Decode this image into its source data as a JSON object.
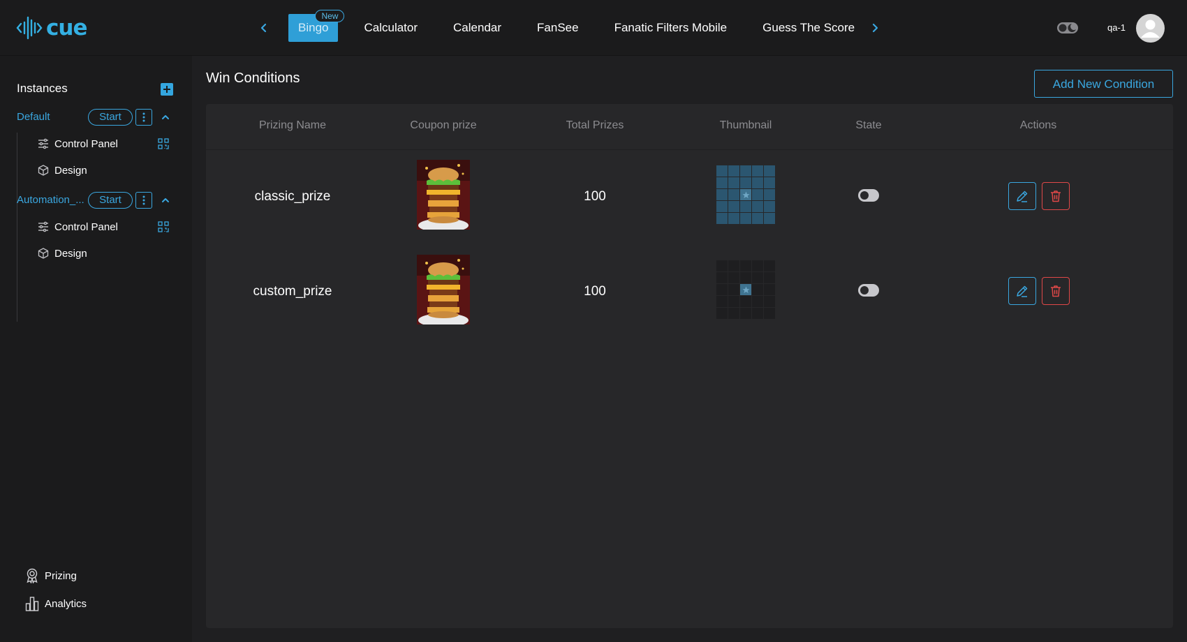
{
  "brand": {
    "name": "cue",
    "color": "#34b0e3"
  },
  "nav": {
    "tabs": [
      {
        "label": "Bingo",
        "badge": "New",
        "active": true
      },
      {
        "label": "Calculator"
      },
      {
        "label": "Calendar"
      },
      {
        "label": "FanSee"
      },
      {
        "label": "Fanatic Filters Mobile"
      },
      {
        "label": "Guess The Score"
      }
    ],
    "prev_icon": "chevron-left-icon",
    "next_icon": "chevron-right-icon"
  },
  "header": {
    "theme_toggle_icon": "dark-mode-toggle-icon",
    "username": "qa-1",
    "avatar_icon": "user-avatar-icon"
  },
  "sidebar": {
    "title": "Instances",
    "instances": [
      {
        "name": "Default",
        "start_label": "Start",
        "items": [
          {
            "label": "Control Panel",
            "icon": "sliders-icon"
          },
          {
            "label": "Design",
            "icon": "cube-icon"
          }
        ]
      },
      {
        "name": "Automation_...",
        "start_label": "Start",
        "items": [
          {
            "label": "Control Panel",
            "icon": "sliders-icon"
          },
          {
            "label": "Design",
            "icon": "cube-icon"
          }
        ]
      }
    ],
    "bottom_links": [
      {
        "label": "Prizing",
        "icon": "award-icon"
      },
      {
        "label": "Analytics",
        "icon": "bar-chart-icon"
      }
    ]
  },
  "main": {
    "title": "Win Conditions",
    "add_button": "Add New Condition",
    "table": {
      "headers": [
        "Prizing Name",
        "Coupon prize",
        "Total Prizes",
        "Thumbnail",
        "State",
        "Actions"
      ],
      "rows": [
        {
          "name": "classic_prize",
          "total": "100",
          "state": false,
          "pattern": "full-card"
        },
        {
          "name": "custom_prize",
          "total": "100",
          "state": false,
          "pattern": "center-only"
        }
      ]
    }
  },
  "colors": {
    "accent": "#3aa7e0",
    "danger": "#e04848",
    "background": "#1f1f21",
    "panel": "#272729"
  }
}
